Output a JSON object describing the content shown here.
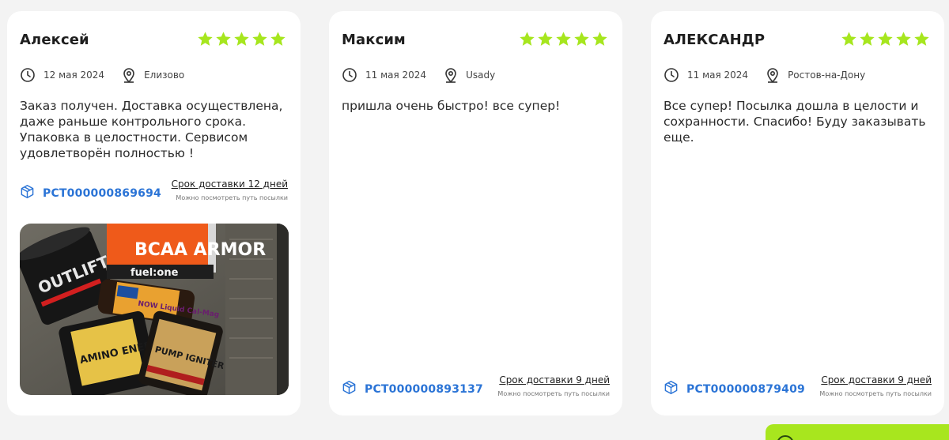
{
  "colors": {
    "star": "#a6e61e",
    "tracking": "#2b74d6",
    "card_bg": "#ffffff",
    "page_bg": "#f3f3f3",
    "accent_tab": "#a8e61e"
  },
  "reviews": [
    {
      "author": "Алексей",
      "rating": 5,
      "date": "12 мая 2024",
      "city": "Елизово",
      "text": "Заказ получен. Доставка осуществлена, даже раньше контрольного срока. Упаковка в целостности. Сервисом удовлетворён полностью !",
      "tracking": "РСТ000000869694",
      "delivery": "Срок доставки 12 дней",
      "delivery_hint": "Можно посмотреть путь посылки",
      "photo": {
        "labels": [
          "OUTLIFT",
          "BCAA ARMOR",
          "fuel:one",
          "NOW Liquid Cal-Mag",
          "AMINO ENERGY",
          "PUMP IGNITER"
        ]
      }
    },
    {
      "author": "Максим",
      "rating": 5,
      "date": "11 мая 2024",
      "city": "Usady",
      "text": "пришла очень быстро! все супер!",
      "tracking": "РСТ000000893137",
      "delivery": "Срок доставки 9 дней",
      "delivery_hint": "Можно посмотреть путь посылки"
    },
    {
      "author": "АЛЕКСАНДР",
      "rating": 5,
      "date": "11 мая 2024",
      "city": "Ростов-на-Дону",
      "text": "Все супер! Посылка дошла в целости и сохранности. Спасибо! Буду заказывать еще.",
      "tracking": "РСТ000000879409",
      "delivery": "Срок доставки 9 дней",
      "delivery_hint": "Можно посмотреть путь посылки"
    }
  ]
}
